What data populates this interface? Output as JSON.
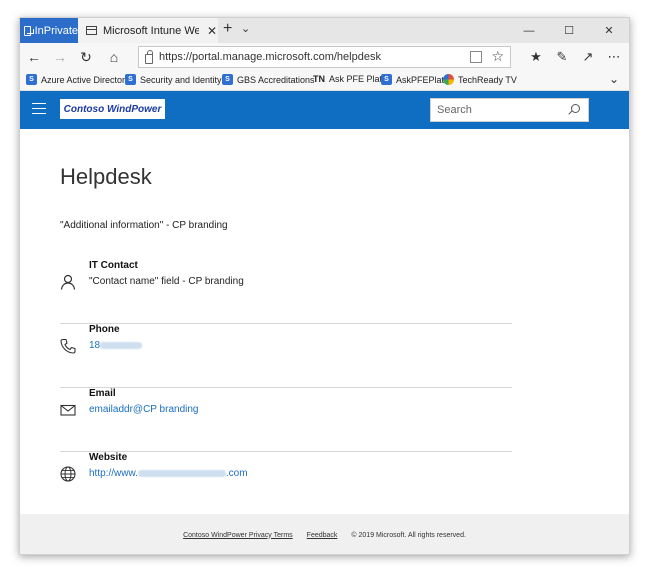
{
  "browser": {
    "inprivate_label": "InPrivate",
    "tab_title": "Microsoft Intune Web C",
    "tab_close": "✕",
    "new_tab": "+",
    "tab_list": "⌄",
    "url": "https://portal.manage.microsoft.com/helpdesk"
  },
  "favorites": [
    {
      "label": "Azure Active Director"
    },
    {
      "label": "Security and Identity"
    },
    {
      "label": "GBS Accreditations"
    },
    {
      "label": "Ask PFE Plat",
      "prefix": "TN"
    },
    {
      "label": "AskPFEPlat"
    },
    {
      "label": "TechReady TV"
    }
  ],
  "site": {
    "logo_text": "Contoso WindPower",
    "search_placeholder": "Search"
  },
  "content": {
    "title": "Helpdesk",
    "additional_info": "\"Additional information\" - CP branding",
    "it_contact": {
      "label": "IT Contact",
      "value": "\"Contact name\" field - CP branding"
    },
    "phone": {
      "label": "Phone",
      "value_prefix": "18"
    },
    "email": {
      "label": "Email",
      "value": "emailaddr@CP branding"
    },
    "website": {
      "label": "Website",
      "value_prefix": "http://www.",
      "value_suffix": ".com"
    }
  },
  "footer": {
    "privacy": "Contoso WindPower Privacy Terms",
    "feedback": "Feedback",
    "copyright": "© 2019 Microsoft. All rights reserved."
  },
  "colors": {
    "header_blue": "#0f6ec1",
    "inprivate_blue": "#2b6dc9",
    "link_blue": "#1a6ec0"
  }
}
